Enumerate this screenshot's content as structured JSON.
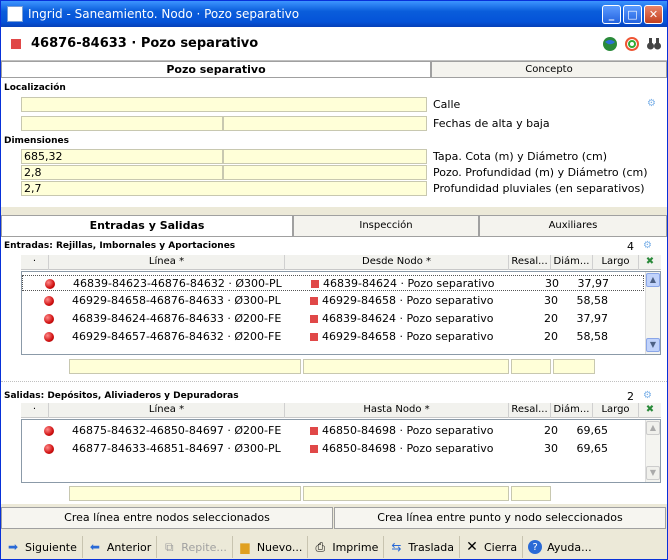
{
  "window": {
    "title": "Ingrid - Saneamiento. Nodo · Pozo separativo"
  },
  "header": {
    "title": "46876-84633 · Pozo separativo",
    "icons": [
      "globe-icon",
      "swirl-icon",
      "binoculars-icon"
    ]
  },
  "tabs_top": [
    {
      "label": "Pozo separativo",
      "active": true
    },
    {
      "label": "Concepto",
      "active": false
    }
  ],
  "location": {
    "section_label": "Localización",
    "calle_label": "Calle",
    "fechas_label": "Fechas de alta y baja",
    "calle_value": "",
    "fecha_alta": "",
    "fecha_baja": ""
  },
  "dimensions": {
    "section_label": "Dimensiones",
    "tapa_cota": "685,32",
    "tapa_diametro": "",
    "pozo_profundidad": "2,8",
    "pozo_diametro": "",
    "profundidad_pluviales": "2,7",
    "tapa_label": "Tapa. Cota (m) y Diámetro (cm)",
    "pozo_label": "Pozo. Profundidad (m) y Diámetro (cm)",
    "pluv_label": "Profundidad pluviales (en separativos)"
  },
  "tabs_mid": [
    {
      "label": "Entradas y Salidas",
      "active": true
    },
    {
      "label": "Inspección",
      "active": false
    },
    {
      "label": "Auxiliares",
      "active": false
    }
  ],
  "entradas": {
    "title": "Entradas: Rejillas, Imbornales y Aportaciones",
    "count": "4",
    "headers": {
      "dot": "·",
      "linea": "Línea *",
      "nodo": "Desde Nodo *",
      "resal": "Resal...",
      "diam": "Diám...",
      "largo": "Largo"
    },
    "rows": [
      {
        "linea": "46839-84623-46876-84632 · Ø300-PL",
        "nodo": "46839-84624 · Pozo separativo",
        "resal": "",
        "diam": "30",
        "largo": "37,97"
      },
      {
        "linea": "46929-84658-46876-84633 · Ø300-PL",
        "nodo": "46929-84658 · Pozo separativo",
        "resal": "",
        "diam": "30",
        "largo": "58,58"
      },
      {
        "linea": "46839-84624-46876-84633 · Ø200-FE",
        "nodo": "46839-84624 · Pozo separativo",
        "resal": "",
        "diam": "20",
        "largo": "37,97"
      },
      {
        "linea": "46929-84657-46876-84632 · Ø200-FE",
        "nodo": "46929-84658 · Pozo separativo",
        "resal": "",
        "diam": "20",
        "largo": "58,58"
      }
    ]
  },
  "salidas": {
    "title": "Salidas: Depósitos, Aliviaderos y Depuradoras",
    "count": "2",
    "headers": {
      "dot": "·",
      "linea": "Línea *",
      "nodo": "Hasta Nodo *",
      "resal": "Resal...",
      "diam": "Diám...",
      "largo": "Largo"
    },
    "rows": [
      {
        "linea": "46875-84632-46850-84697 · Ø200-FE",
        "nodo": "46850-84698 · Pozo separativo",
        "resal": "",
        "diam": "20",
        "largo": "69,65"
      },
      {
        "linea": "46877-84633-46851-84697 · Ø300-PL",
        "nodo": "46850-84698 · Pozo separativo",
        "resal": "",
        "diam": "30",
        "largo": "69,65"
      }
    ]
  },
  "actions": {
    "crea_nodos": "Crea línea entre nodos seleccionados",
    "crea_punto": "Crea línea entre punto y nodo seleccionados"
  },
  "toolbar": {
    "siguiente": "Siguiente",
    "anterior": "Anterior",
    "repite": "Repite...",
    "nuevo": "Nuevo...",
    "imprime": "Imprime",
    "traslada": "Traslada",
    "cierra": "Cierra",
    "ayuda": "Ayuda..."
  },
  "colors": {
    "field_bg": "#ffffd8",
    "title_bar": "#0553d8",
    "node_red": "#e04848"
  }
}
